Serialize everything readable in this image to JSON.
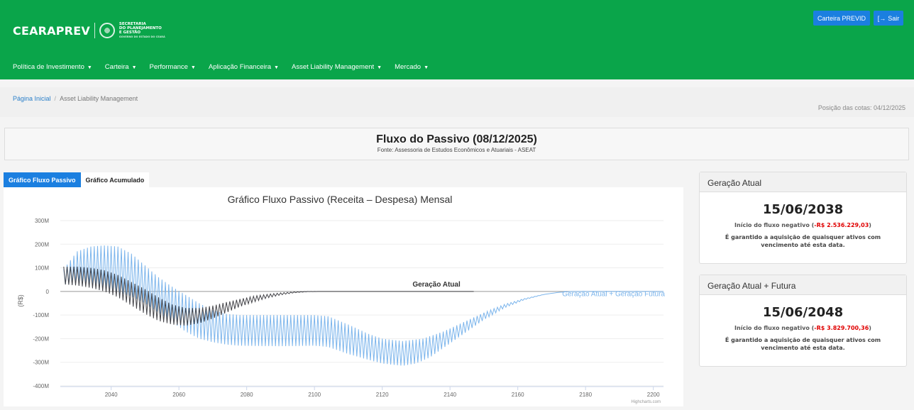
{
  "header": {
    "logo_text": "CEARAPREV",
    "logo_sub_line1": "SECRETARIA",
    "logo_sub_line2": "DO PLANEJAMENTO",
    "logo_sub_line3": "E GESTÃO",
    "logo_sub_line4": "GOVERNO DO ESTADO DO CEARÁ",
    "btn_previd": "Carteira PREVID",
    "btn_sair": "Sair",
    "menu": [
      {
        "label": "Política de Investimento"
      },
      {
        "label": "Carteira"
      },
      {
        "label": "Performance"
      },
      {
        "label": "Aplicação Financeira"
      },
      {
        "label": "Asset Liability Management"
      },
      {
        "label": "Mercado"
      }
    ],
    "brand_color": "#0aa54a",
    "button_color": "#1b7fe0"
  },
  "breadcrumb": {
    "home": "Página Inicial",
    "current": "Asset Liability Management",
    "cotas": "Posição das cotas: 04/12/2025"
  },
  "title": {
    "main": "Fluxo do Passivo (08/12/2025)",
    "source": "Fonte: Assessoria de Estudos Econômicos e Atuariais - ASEAT"
  },
  "tabs": [
    {
      "label": "Gráfico Fluxo Passivo",
      "active": true
    },
    {
      "label": "Gráfico Acumulado",
      "active": false
    }
  ],
  "cards": [
    {
      "title": "Geração Atual",
      "date": "15/06/2038",
      "neg_prefix": "Início do fluxo negativo (",
      "neg_value": "-R$ 2.536.229,03",
      "neg_suffix": ")",
      "guarantee": "É garantido a aquisição de quaisquer ativos com vencimento até esta data."
    },
    {
      "title": "Geração Atual + Futura",
      "date": "15/06/2048",
      "neg_prefix": "Início do fluxo negativo (",
      "neg_value": "-R$ 3.829.700,36",
      "neg_suffix": ")",
      "guarantee": "É garantido a aquisição de quaisquer ativos com vencimento até esta data."
    }
  ],
  "chart_data": {
    "type": "line",
    "title": "Gráfico Fluxo Passivo (Receita – Despesa) Mensal",
    "ylabel": "(R$)",
    "credit": "Highcharts.com",
    "xlim": [
      2025,
      2203
    ],
    "ylim": [
      -400,
      300
    ],
    "y_unit": "M",
    "y_ticks": [
      "300M",
      "200M",
      "100M",
      "0",
      "-100M",
      "-200M",
      "-300M",
      "-400M"
    ],
    "y_tick_values": [
      300,
      200,
      100,
      0,
      -100,
      -200,
      -300,
      -400
    ],
    "x_ticks": [
      2040,
      2060,
      2080,
      2100,
      2120,
      2140,
      2160,
      2180,
      2200
    ],
    "series": [
      {
        "name": "Geração Atual + Geração Futura",
        "color": "#7cb5ec",
        "end_year": 2203,
        "envelope_upper": [
          [
            2026,
            95
          ],
          [
            2030,
            170
          ],
          [
            2034,
            190
          ],
          [
            2038,
            195
          ],
          [
            2042,
            190
          ],
          [
            2046,
            160
          ],
          [
            2050,
            110
          ],
          [
            2054,
            60
          ],
          [
            2058,
            20
          ],
          [
            2062,
            -15
          ],
          [
            2066,
            -50
          ],
          [
            2070,
            -80
          ],
          [
            2074,
            -95
          ],
          [
            2078,
            -100
          ],
          [
            2090,
            -100
          ],
          [
            2100,
            -100
          ],
          [
            2104,
            -105
          ],
          [
            2110,
            -140
          ],
          [
            2116,
            -180
          ],
          [
            2120,
            -200
          ],
          [
            2126,
            -210
          ],
          [
            2132,
            -200
          ],
          [
            2138,
            -170
          ],
          [
            2144,
            -130
          ],
          [
            2150,
            -90
          ],
          [
            2156,
            -55
          ],
          [
            2162,
            -30
          ],
          [
            2168,
            -12
          ],
          [
            2172,
            -4
          ],
          [
            2176,
            0
          ],
          [
            2203,
            0
          ]
        ],
        "envelope_lower": [
          [
            2026,
            30
          ],
          [
            2030,
            30
          ],
          [
            2034,
            20
          ],
          [
            2038,
            5
          ],
          [
            2042,
            -5
          ],
          [
            2046,
            -20
          ],
          [
            2050,
            -50
          ],
          [
            2054,
            -90
          ],
          [
            2058,
            -130
          ],
          [
            2062,
            -170
          ],
          [
            2066,
            -200
          ],
          [
            2070,
            -215
          ],
          [
            2074,
            -225
          ],
          [
            2078,
            -230
          ],
          [
            2090,
            -232
          ],
          [
            2100,
            -230
          ],
          [
            2104,
            -235
          ],
          [
            2110,
            -265
          ],
          [
            2116,
            -290
          ],
          [
            2120,
            -305
          ],
          [
            2126,
            -315
          ],
          [
            2130,
            -305
          ],
          [
            2134,
            -280
          ],
          [
            2138,
            -240
          ],
          [
            2144,
            -180
          ],
          [
            2150,
            -120
          ],
          [
            2156,
            -70
          ],
          [
            2162,
            -35
          ],
          [
            2168,
            -12
          ],
          [
            2172,
            -4
          ],
          [
            2176,
            0
          ],
          [
            2203,
            0
          ]
        ]
      },
      {
        "name": "Geração Atual",
        "color": "#434348",
        "end_year": 2147,
        "envelope_upper": [
          [
            2026,
            105
          ],
          [
            2030,
            105
          ],
          [
            2034,
            100
          ],
          [
            2038,
            90
          ],
          [
            2042,
            70
          ],
          [
            2046,
            40
          ],
          [
            2050,
            10
          ],
          [
            2054,
            -25
          ],
          [
            2058,
            -55
          ],
          [
            2062,
            -70
          ],
          [
            2066,
            -70
          ],
          [
            2070,
            -60
          ],
          [
            2074,
            -45
          ],
          [
            2078,
            -32
          ],
          [
            2082,
            -20
          ],
          [
            2086,
            -12
          ],
          [
            2090,
            -6
          ],
          [
            2094,
            -2
          ],
          [
            2098,
            0
          ],
          [
            2147,
            0
          ]
        ],
        "envelope_lower": [
          [
            2026,
            30
          ],
          [
            2030,
            25
          ],
          [
            2034,
            15
          ],
          [
            2038,
            0
          ],
          [
            2042,
            -25
          ],
          [
            2046,
            -60
          ],
          [
            2050,
            -95
          ],
          [
            2054,
            -125
          ],
          [
            2058,
            -140
          ],
          [
            2062,
            -145
          ],
          [
            2066,
            -135
          ],
          [
            2070,
            -115
          ],
          [
            2074,
            -90
          ],
          [
            2078,
            -65
          ],
          [
            2082,
            -45
          ],
          [
            2086,
            -28
          ],
          [
            2090,
            -15
          ],
          [
            2094,
            -6
          ],
          [
            2098,
            -1
          ],
          [
            2102,
            0
          ],
          [
            2147,
            0
          ]
        ]
      }
    ],
    "series_labels": [
      "Geração Atual",
      "Geração Atual + Geração Futura"
    ]
  }
}
